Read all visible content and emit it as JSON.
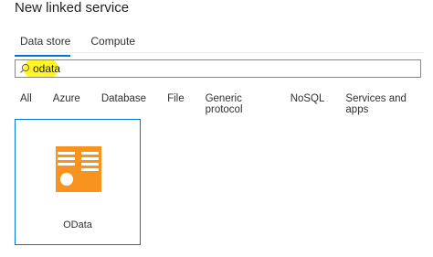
{
  "dialog": {
    "title": "New linked service"
  },
  "tabs": [
    {
      "label": "Data store"
    },
    {
      "label": "Compute"
    }
  ],
  "search": {
    "value": "odata",
    "highlight_color": "#fff200"
  },
  "filters": [
    {
      "label": "All"
    },
    {
      "label": "Azure"
    },
    {
      "label": "Database"
    },
    {
      "label": "File"
    },
    {
      "label": "Generic protocol"
    },
    {
      "label": "NoSQL"
    },
    {
      "label": "Services and apps"
    }
  ],
  "results": [
    {
      "label": "OData",
      "icon": "odata-icon",
      "color": "#f7931e"
    }
  ],
  "colors": {
    "accent": "#0078d4"
  }
}
